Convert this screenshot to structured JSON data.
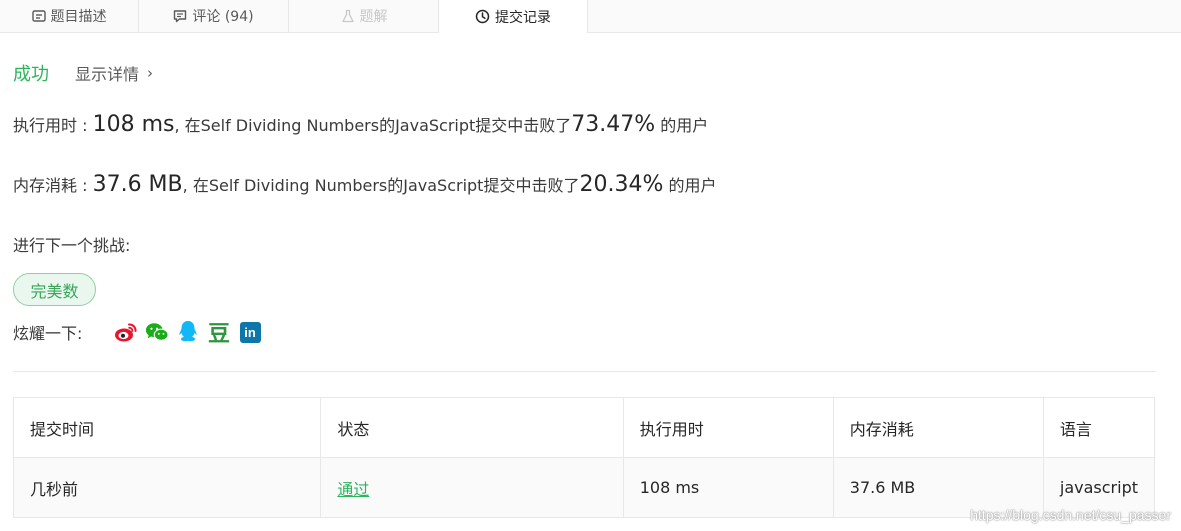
{
  "tabs": [
    {
      "label": "题目描述",
      "icon": "description-icon"
    },
    {
      "label": "评论 (94)",
      "icon": "comment-icon"
    },
    {
      "label": "题解",
      "icon": "flask-icon"
    },
    {
      "label": "提交记录",
      "icon": "clock-icon"
    }
  ],
  "result": {
    "status": "成功",
    "show_detail": "显示详情",
    "runtime_label": "执行用时 : ",
    "runtime_value": "108 ms",
    "runtime_mid": ", 在Self Dividing Numbers的JavaScript提交中击败了",
    "runtime_percent": "73.47%",
    "runtime_suffix": " 的用户",
    "memory_label": "内存消耗 : ",
    "memory_value": "37.6 MB",
    "memory_mid": ", 在Self Dividing Numbers的JavaScript提交中击败了",
    "memory_percent": "20.34%",
    "memory_suffix": " 的用户"
  },
  "next": {
    "label": "进行下一个挑战:",
    "challenge": "完美数"
  },
  "share": {
    "label": "炫耀一下:",
    "icons": [
      "weibo-icon",
      "wechat-icon",
      "qq-icon",
      "douban-icon",
      "linkedin-icon"
    ],
    "douban_glyph": "豆",
    "linkedin_glyph": "in"
  },
  "table": {
    "headers": [
      "提交时间",
      "状态",
      "执行用时",
      "内存消耗",
      "语言"
    ],
    "rows": [
      [
        "几秒前",
        "通过",
        "108 ms",
        "37.6 MB",
        "javascript"
      ]
    ]
  },
  "colors": {
    "accent": "#2db55d",
    "weibo": "#e6162d",
    "wechat": "#1aad19",
    "qq": "#12b7f5",
    "douban": "#2e963d",
    "linkedin": "#0e76a8"
  },
  "watermark": "https://blog.csdn.net/csu_passer"
}
